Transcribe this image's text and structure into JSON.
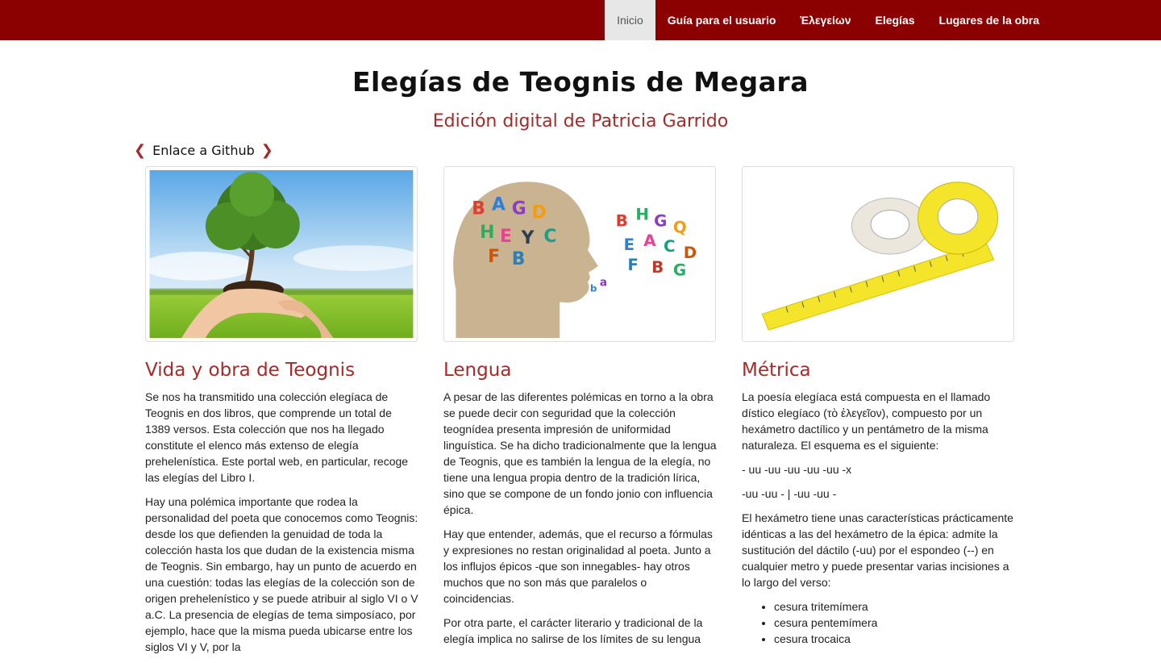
{
  "nav": {
    "items": [
      {
        "label": "Inicio"
      },
      {
        "label": "Guía para el usuario"
      },
      {
        "label": "Ἐλεγείων"
      },
      {
        "label": "Elegías"
      },
      {
        "label": "Lugares de la obra"
      }
    ]
  },
  "header": {
    "title": "Elegías de Teognis de Megara",
    "subtitle": "Edición digital de Patricia Garrido"
  },
  "github": {
    "label": "Enlace a Github"
  },
  "sections": [
    {
      "heading": "Vida y obra de Teognis",
      "paragraphs": [
        "Se nos ha transmitido una colección elegíaca de Teognis en dos libros, que comprende un total de 1389 versos. Esta colección que nos ha llegado constitute el elenco más extenso de elegía prehelenística. Este portal web, en particular, recoge las elegías del Libro I.",
        "Hay una polémica importante que rodea la personalidad del poeta que conocemos como Teognis: desde los que defienden la genuidad de toda la colección hasta los que dudan de la existencia misma de Teognis. Sin embargo, hay un punto de acuerdo en una cuestión: todas las elegías de la colección son de origen prehelenístico y se puede atribuir al siglo VI o V a.C. La presencia de elegías de tema simposíaco, por ejemplo, hace que la misma pueda ubicarse entre los siglos VI y V, por la"
      ]
    },
    {
      "heading": "Lengua",
      "paragraphs": [
        "A pesar de las diferentes polémicas en torno a la obra se puede decir con seguridad que la colección teognídea presenta impresión de uniformidad linguística. Se ha dicho tradicionalmente que la lengua de Teognis, que es también la lengua de la elegía, no tiene una lengua propia dentro de la tradición lírica, sino que se compone de un fondo jonio con influencia épica.",
        "Hay que entender, además, que el recurso a fórmulas y expresiones no restan originalidad al poeta. Junto a los influjos épicos -que son innegables- hay otros muchos que no son más que paralelos o coincidencias.",
        "Por otra parte, el carácter literario y tradicional de la elegía implica no salirse de los límites de su lengua"
      ]
    },
    {
      "heading": "Métrica",
      "paragraphs": [
        "La poesía elegíaca está compuesta en el llamado dístico elegíaco (τὸ ἐλεγεῖον), compuesto por un hexámetro dactílico y un pentámetro de la misma naturaleza. El esquema es el siguiente:",
        "- uu -uu -uu -uu -uu -x",
        "-uu -uu - | -uu -uu -",
        "El hexámetro tiene unas características prácticamente idénticas a las del hexámetro de la épica: admite la sustitución del dáctilo (-uu) por el espondeo (--) en cualquier metro y puede presentar varias incisiones a lo largo del verso:"
      ],
      "list": [
        "cesura tritemímera",
        "cesura pentemímera",
        "cesura trocaica"
      ]
    }
  ]
}
